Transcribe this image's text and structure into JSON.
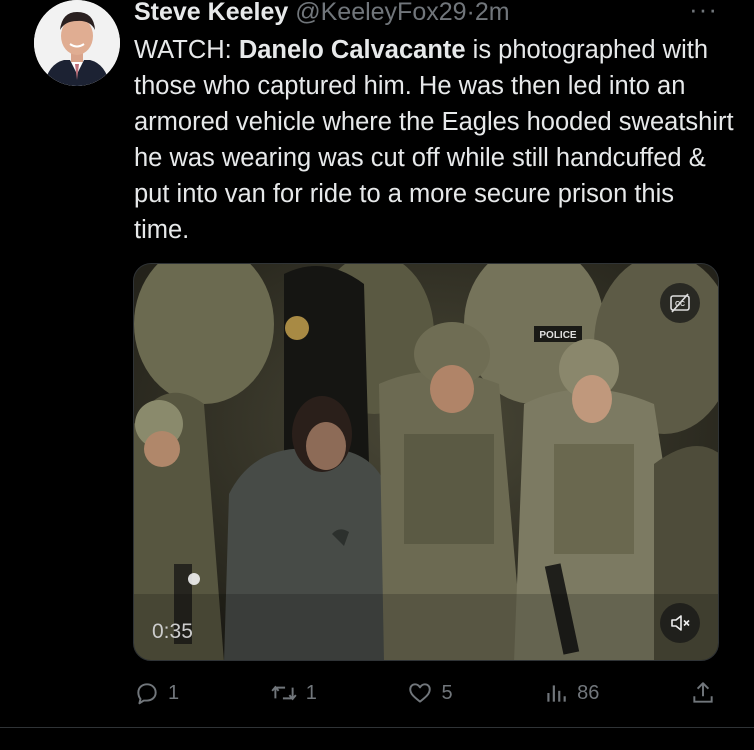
{
  "tweet": {
    "author_name": "Steve Keeley",
    "handle": "@KeeleyFox29",
    "separator": "·",
    "time": "2m",
    "more_label": "···",
    "text_prefix": "WATCH:  ",
    "text_bold": "Danelo Calvacante",
    "text_suffix": " is photographed with those who captured him.   He was then led into an armored vehicle where the Eagles hooded sweatshirt he was wearing was cut off while still handcuffed & put into van for ride to a more secure prison this time."
  },
  "video": {
    "duration": "0:35",
    "badge_text": "POLICE"
  },
  "actions": {
    "replies": "1",
    "reposts": "1",
    "likes": "5",
    "views": "86"
  },
  "colors": {
    "background": "#000000",
    "text": "#e7e9ea",
    "muted": "#71767b"
  }
}
